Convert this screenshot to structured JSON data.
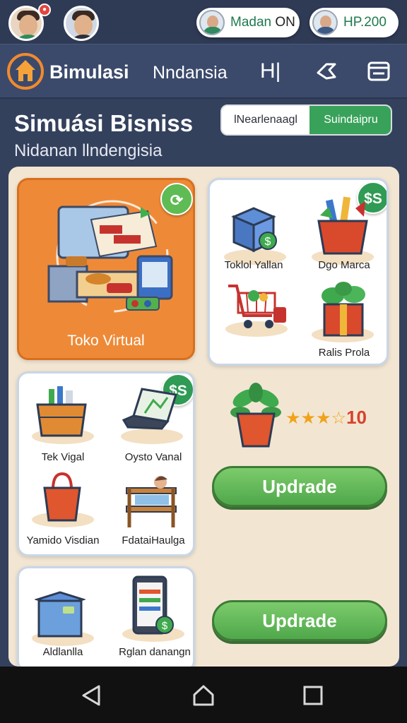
{
  "topbar": {
    "pill_left": {
      "name": "Madan",
      "status": "ON"
    },
    "pill_right": {
      "label": "HP.200"
    }
  },
  "nav": {
    "title": "Bimulasi",
    "subtitle": "Nndansia",
    "icon3_text": "H|"
  },
  "header": {
    "title": "Simuási Bisniss",
    "subtitle": "Nidanan llndengisia",
    "toggle_left": "lNearlenaagl",
    "toggle_right": "Suindaipru"
  },
  "cards": {
    "toko": {
      "label": "Toko Virtual"
    },
    "shop_grid": {
      "badge": "$S",
      "items": [
        "Toklol Yallan",
        "Dgo Marca",
        "",
        "Ralis Prola"
      ]
    },
    "left_grid": {
      "badge": "$S",
      "items": [
        "Tek Vigal",
        "Oysto Vanal",
        "Yamido Visdian",
        "FdataiHaulga"
      ]
    },
    "bottom_grid": {
      "items": [
        "Aldlanlla",
        "Rglan danangn"
      ]
    }
  },
  "rating": {
    "stars": "★★★☆",
    "value": "10"
  },
  "buttons": {
    "upgrade1": "Updrade",
    "upgrade2": "Updrade"
  },
  "colors": {
    "accent_green": "#39a25a",
    "orange": "#ee8a37",
    "navy": "#3b4a6b"
  }
}
